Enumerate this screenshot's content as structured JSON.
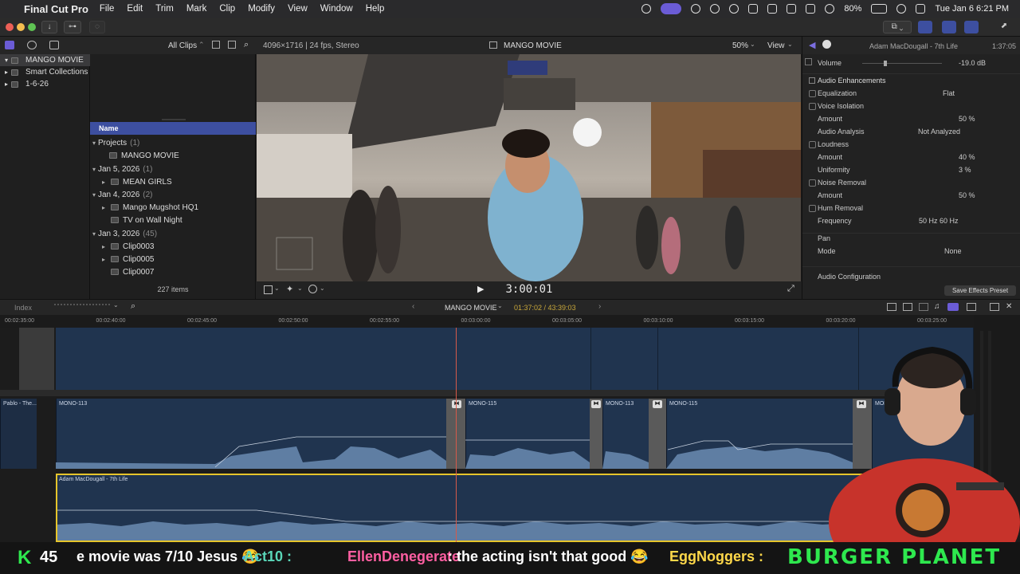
{
  "menubar": {
    "app_name": "Final Cut Pro",
    "menus": [
      "File",
      "Edit",
      "Trim",
      "Mark",
      "Clip",
      "Modify",
      "View",
      "Window",
      "Help"
    ],
    "battery": "80%",
    "datetime": "Tue Jan 6  6:21 PM"
  },
  "browser": {
    "library": "MANGO MOVIE",
    "library_items": [
      "Smart Collections",
      "1-6-26"
    ],
    "filter_label": "All Clips",
    "column_name": "Name",
    "groups": [
      {
        "label": "Projects",
        "count": "(1)",
        "items": [
          "MANGO MOVIE"
        ]
      },
      {
        "label": "Jan 5, 2026",
        "count": "(1)",
        "items": [
          "MEAN GIRLS"
        ]
      },
      {
        "label": "Jan 4, 2026",
        "count": "(2)",
        "items": [
          "Mango Mugshot HQ1",
          "TV on Wall Night"
        ]
      },
      {
        "label": "Jan 3, 2026",
        "count": "(45)",
        "items": [
          "Clip0003",
          "Clip0005",
          "Clip0007"
        ]
      }
    ],
    "item_count": "227 items"
  },
  "viewer": {
    "format": "4096×1716 | 24 fps, Stereo",
    "title": "MANGO MOVIE",
    "zoom": "50%",
    "view_label": "View",
    "timecode": "3:00:01"
  },
  "inspector": {
    "clip_name": "Adam MacDougall - 7th Life",
    "duration": "1:37:05",
    "volume_label": "Volume",
    "volume_value": "-19.0  dB",
    "section_title": "Audio Enhancements",
    "rows": [
      {
        "label": "Equalization",
        "value": "Flat",
        "checkbox": true
      },
      {
        "label": "Voice Isolation",
        "value": "",
        "checkbox": true
      },
      {
        "label": "Amount",
        "value": "50  %",
        "checkbox": false
      },
      {
        "label": "Audio Analysis",
        "value": "Not Analyzed",
        "checkbox": false
      },
      {
        "label": "Loudness",
        "value": "",
        "checkbox": true
      },
      {
        "label": "Amount",
        "value": "40  %",
        "checkbox": false
      },
      {
        "label": "Uniformity",
        "value": "3  %",
        "checkbox": false
      },
      {
        "label": "Noise Removal",
        "value": "",
        "checkbox": true
      },
      {
        "label": "Amount",
        "value": "50  %",
        "checkbox": false
      },
      {
        "label": "Hum Removal",
        "value": "",
        "checkbox": true
      },
      {
        "label": "Frequency",
        "value": "50 Hz     60 Hz",
        "checkbox": false
      }
    ],
    "pan_label": "Pan",
    "mode_label": "Mode",
    "mode_value": "None",
    "audio_config": "Audio Configuration",
    "save_preset": "Save Effects Preset"
  },
  "timeline": {
    "index_label": "Index",
    "project": "MANGO MOVIE",
    "position": "01:37:02 / 43:39:03",
    "ruler_labels": [
      "00:02:35:00",
      "00:02:40:00",
      "00:02:45:00",
      "00:02:50:00",
      "00:02:55:00",
      "00:03:00:00",
      "00:03:05:00",
      "00:03:10:00",
      "00:03:15:00",
      "00:03:20:00",
      "00:03:25:00"
    ],
    "clips": [
      "Pablo - The...",
      "MONO-113",
      "MONO-115",
      "MONO-113",
      "MONO-115",
      "MONO"
    ],
    "main_audio": "Adam MacDougall - 7th Life"
  },
  "ticker": {
    "k_label": "K",
    "k_count": "45",
    "chat": [
      {
        "text": "e movie was 7/10 Jesus 😂",
        "color": "#ffffff"
      },
      {
        "text": "Act10 :",
        "color": "#5ad6b8"
      },
      {
        "text": "EllenDenegerate",
        "color": "#ff5fa2"
      },
      {
        "text": ": the acting isn't that good 😂",
        "color": "#ffffff"
      },
      {
        "text": "EggNoggers :",
        "color": "#ffd84a"
      }
    ],
    "brand": "BURGER PLANET"
  },
  "colors": {
    "accent": "#3d4fa0",
    "playhead": "#d65a4a",
    "selection": "#e6c52b",
    "clip": "#20344f",
    "ticker_green": "#2ee84e"
  }
}
